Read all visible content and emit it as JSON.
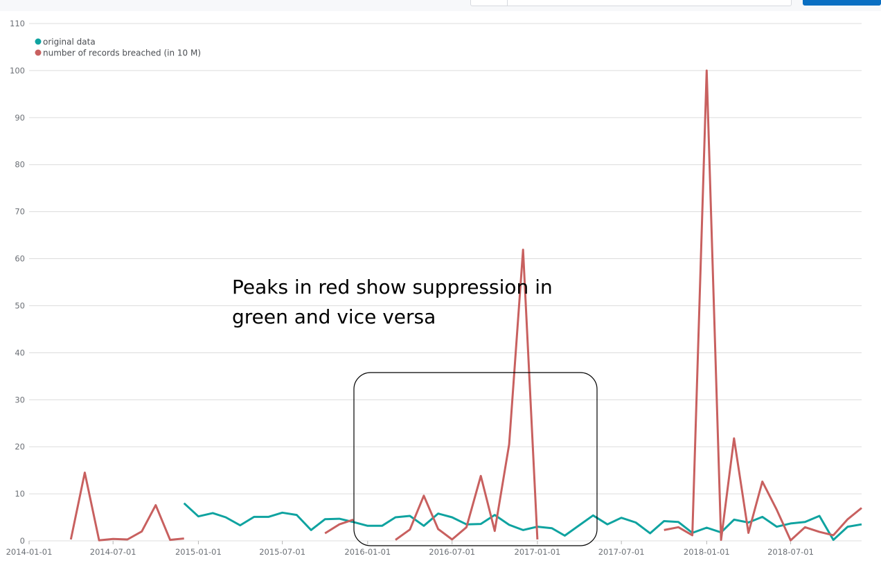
{
  "colors": {
    "original": "#0fa3a0",
    "breached": "#c8605f",
    "grid": "#dcdcdc",
    "accent": "#0a6fc2"
  },
  "annotation": {
    "line1": "Peaks in red show suppression in",
    "line2": "green and vice versa"
  },
  "chart_data": {
    "type": "line",
    "title": "",
    "xlabel": "",
    "ylabel": "",
    "ylim": [
      0,
      110
    ],
    "xlim": [
      "2014-01-01",
      "2018-12-01"
    ],
    "yticks": [
      0,
      10,
      20,
      30,
      40,
      50,
      60,
      70,
      80,
      90,
      100,
      110
    ],
    "xticks": [
      "2014-01-01",
      "2014-07-01",
      "2015-01-01",
      "2015-07-01",
      "2016-01-01",
      "2016-07-01",
      "2017-01-01",
      "2017-07-01",
      "2018-01-01",
      "2018-07-01"
    ],
    "legend_position": "top-left",
    "grid": true,
    "series": [
      {
        "name": "original data",
        "color": "#0fa3a0",
        "points": [
          [
            "2014-12-01",
            8.0
          ],
          [
            "2015-01-01",
            5.2
          ],
          [
            "2015-02-01",
            5.9
          ],
          [
            "2015-03-01",
            5.0
          ],
          [
            "2015-04-01",
            3.3
          ],
          [
            "2015-05-01",
            5.1
          ],
          [
            "2015-06-01",
            5.1
          ],
          [
            "2015-07-01",
            6.0
          ],
          [
            "2015-08-01",
            5.5
          ],
          [
            "2015-09-01",
            2.3
          ],
          [
            "2015-10-01",
            4.6
          ],
          [
            "2015-11-01",
            4.7
          ],
          [
            "2015-12-01",
            4.0
          ],
          [
            "2016-01-01",
            3.2
          ],
          [
            "2016-02-01",
            3.2
          ],
          [
            "2016-03-01",
            5.0
          ],
          [
            "2016-04-01",
            5.3
          ],
          [
            "2016-05-01",
            3.2
          ],
          [
            "2016-06-01",
            5.8
          ],
          [
            "2016-07-01",
            5.0
          ],
          [
            "2016-08-01",
            3.5
          ],
          [
            "2016-09-01",
            3.6
          ],
          [
            "2016-10-01",
            5.5
          ],
          [
            "2016-11-01",
            3.4
          ],
          [
            "2016-12-01",
            2.3
          ],
          [
            "2017-01-01",
            3.0
          ],
          [
            "2017-02-01",
            2.7
          ],
          [
            "2017-03-01",
            1.1
          ],
          [
            "2017-04-01",
            3.3
          ],
          [
            "2017-05-01",
            5.4
          ],
          [
            "2017-06-01",
            3.5
          ],
          [
            "2017-07-01",
            4.9
          ],
          [
            "2017-08-01",
            3.9
          ],
          [
            "2017-09-01",
            1.6
          ],
          [
            "2017-10-01",
            4.2
          ],
          [
            "2017-11-01",
            4.0
          ],
          [
            "2017-12-01",
            1.7
          ],
          [
            "2018-01-01",
            2.8
          ],
          [
            "2018-02-01",
            1.8
          ],
          [
            "2018-03-01",
            4.5
          ],
          [
            "2018-04-01",
            3.9
          ],
          [
            "2018-05-01",
            5.1
          ],
          [
            "2018-06-01",
            3.0
          ],
          [
            "2018-07-01",
            3.7
          ],
          [
            "2018-08-01",
            4.0
          ],
          [
            "2018-09-01",
            5.3
          ],
          [
            "2018-10-01",
            0.2
          ],
          [
            "2018-11-01",
            3.0
          ],
          [
            "2018-12-01",
            3.5
          ]
        ]
      },
      {
        "name": "number of records breached (in 10 M)",
        "color": "#c8605f",
        "segments": [
          [
            [
              "2014-04-01",
              0.3
            ],
            [
              "2014-05-01",
              14.5
            ],
            [
              "2014-06-01",
              0.1
            ],
            [
              "2014-07-01",
              0.4
            ],
            [
              "2014-08-01",
              0.3
            ],
            [
              "2014-09-01",
              2.0
            ],
            [
              "2014-10-01",
              7.6
            ],
            [
              "2014-11-01",
              0.2
            ],
            [
              "2014-12-01",
              0.5
            ]
          ],
          [
            [
              "2015-10-01",
              1.6
            ],
            [
              "2015-11-01",
              3.5
            ],
            [
              "2015-12-01",
              4.5
            ]
          ],
          [
            [
              "2016-03-01",
              0.2
            ],
            [
              "2016-04-01",
              2.4
            ],
            [
              "2016-05-01",
              9.6
            ],
            [
              "2016-06-01",
              2.5
            ],
            [
              "2016-07-01",
              0.3
            ],
            [
              "2016-08-01",
              2.9
            ],
            [
              "2016-09-01",
              13.8
            ],
            [
              "2016-10-01",
              2.1
            ],
            [
              "2016-11-01",
              20.5
            ],
            [
              "2016-12-01",
              61.9
            ],
            [
              "2017-01-01",
              0.3
            ]
          ],
          [
            [
              "2017-10-01",
              2.3
            ],
            [
              "2017-11-01",
              2.9
            ],
            [
              "2017-12-01",
              1.2
            ],
            [
              "2018-01-01",
              100.0
            ],
            [
              "2018-02-01",
              0.2
            ],
            [
              "2018-03-01",
              21.8
            ],
            [
              "2018-04-01",
              1.7
            ],
            [
              "2018-05-01",
              12.6
            ],
            [
              "2018-06-01",
              6.6
            ],
            [
              "2018-07-01",
              0.1
            ],
            [
              "2018-08-01",
              2.9
            ],
            [
              "2018-09-01",
              1.9
            ],
            [
              "2018-10-01",
              1.2
            ],
            [
              "2018-11-01",
              4.6
            ],
            [
              "2018-12-01",
              7.0
            ]
          ]
        ]
      }
    ]
  }
}
